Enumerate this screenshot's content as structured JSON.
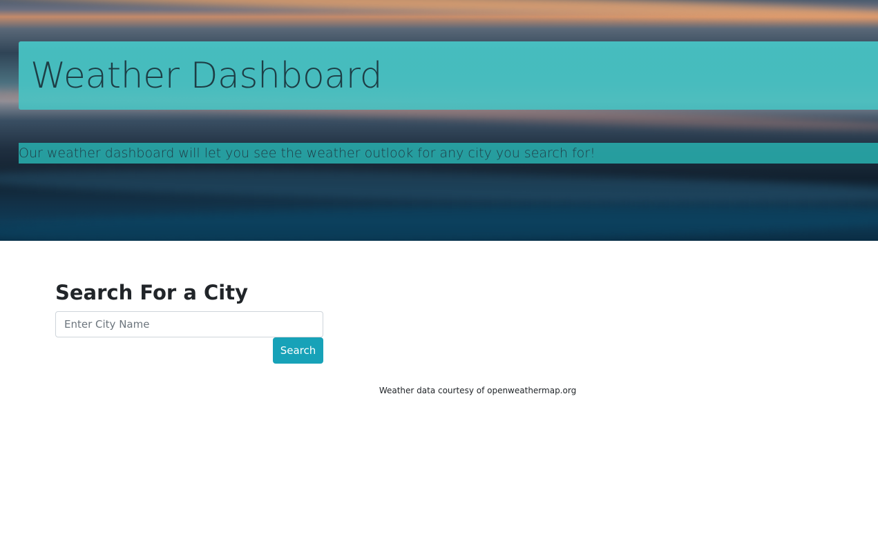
{
  "header": {
    "title": "Weather Dashboard",
    "subtitle": "Our weather dashboard will let you see the weather outlook for any city you search for!"
  },
  "search": {
    "heading": "Search For a City",
    "placeholder": "Enter City Name",
    "value": "",
    "button_label": "Search"
  },
  "footer": {
    "credit": "Weather data courtesy of openweathermap.org"
  },
  "colors": {
    "title_bar": "#48c8c8",
    "subtitle_bar": "#28aaaa",
    "button": "#17a2b8",
    "text_dark": "#212529"
  }
}
